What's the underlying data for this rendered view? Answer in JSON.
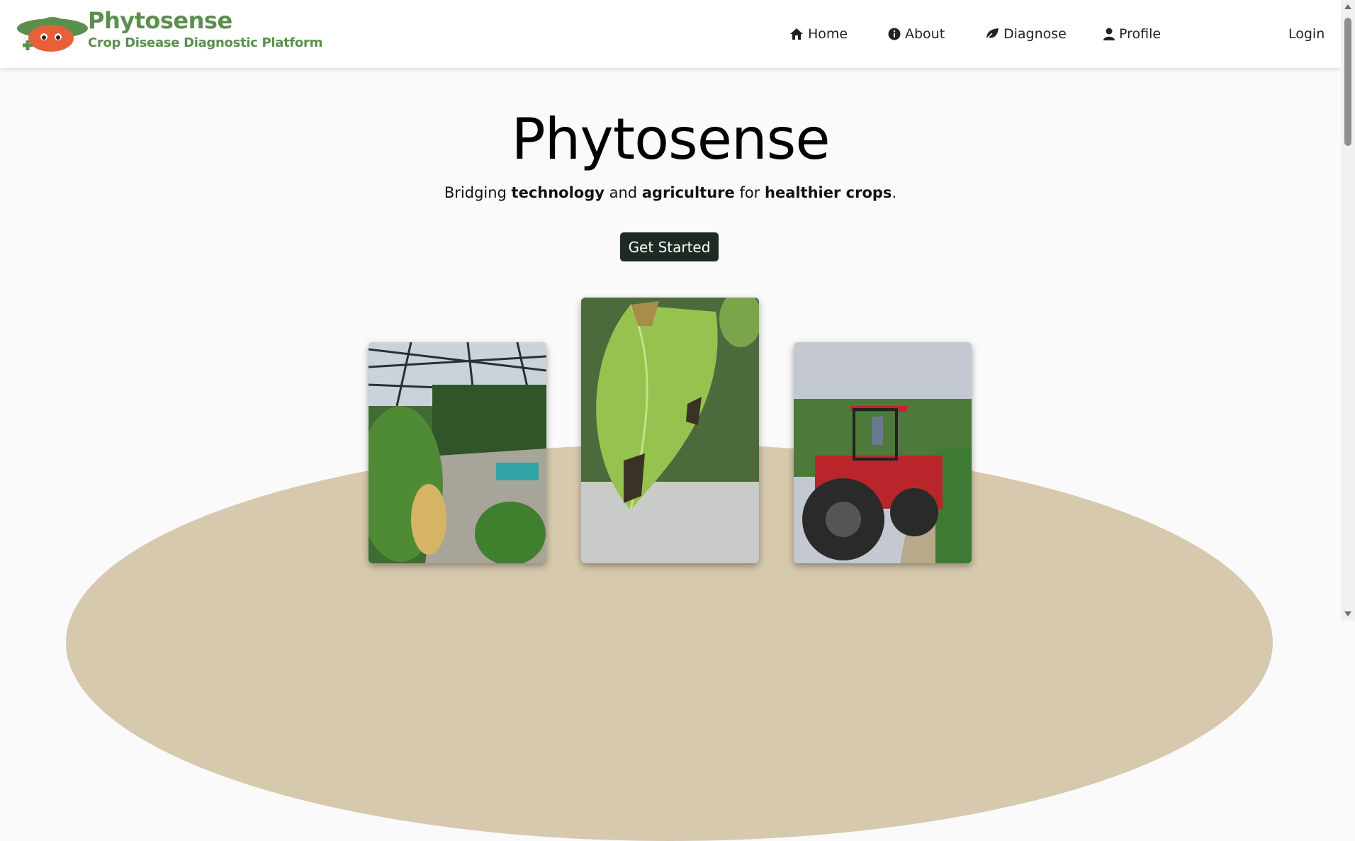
{
  "header": {
    "brand_name": "Phytosense",
    "brand_tagline": "Crop Disease Diagnostic Platform",
    "nav": {
      "home": "Home",
      "about": "About",
      "diagnose": "Diagnose",
      "profile": "Profile",
      "login": "Login"
    }
  },
  "hero": {
    "title": "Phytosense",
    "subtitle": {
      "part1": "Bridging ",
      "bold1": "technology",
      "part2": " and ",
      "bold2": "agriculture",
      "part3": " for ",
      "bold3": "healthier crops",
      "part4": "."
    },
    "cta_label": "Get Started"
  },
  "colors": {
    "brand_green": "#5b8f4e",
    "cta_background": "#1f2a23",
    "oval_beige": "#d7c9ae"
  },
  "icons": {
    "home": "home-icon",
    "about": "info-circle-icon",
    "diagnose": "leaf-icon",
    "profile": "user-icon"
  }
}
